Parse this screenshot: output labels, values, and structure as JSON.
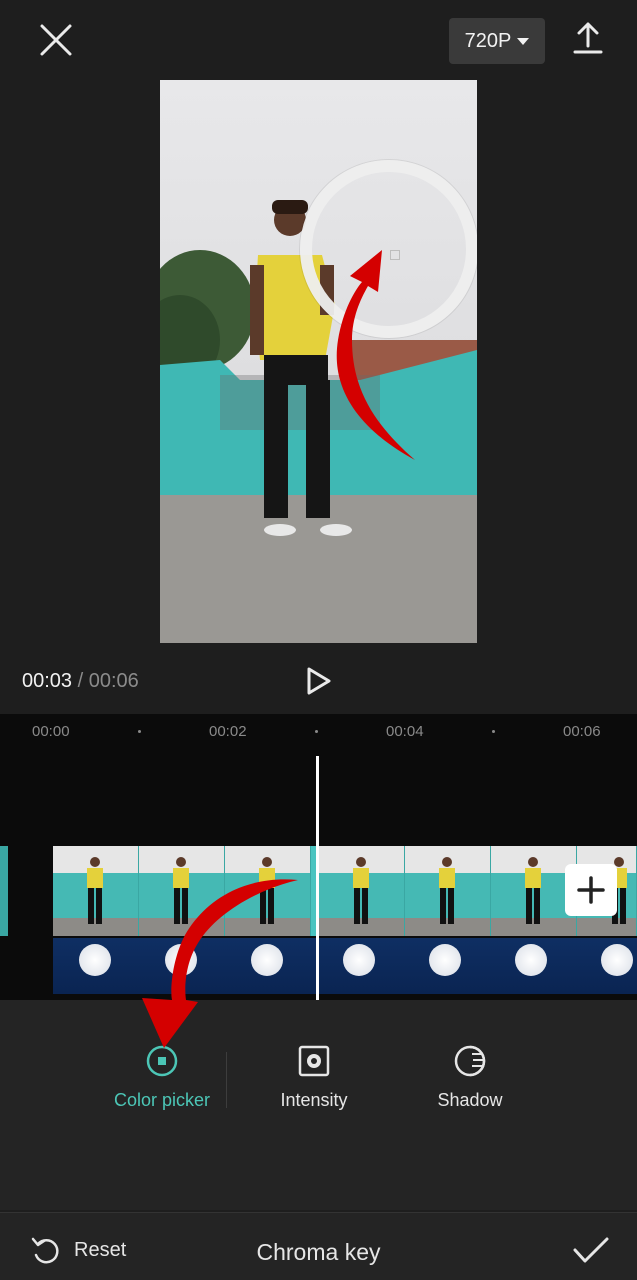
{
  "topbar": {
    "close_icon": "close-icon",
    "resolution_label": "720P",
    "export_icon": "export-upload-icon"
  },
  "preview": {
    "picker_icon": "color-picker-ring"
  },
  "playback": {
    "current_time": "00:03",
    "separator": " / ",
    "total_time": "00:06",
    "play_icon": "play-icon"
  },
  "timeline": {
    "ticks": [
      "00:00",
      "00:02",
      "00:04",
      "00:06"
    ],
    "add_icon": "plus-icon"
  },
  "tools": [
    {
      "label": "Color picker",
      "icon": "color-picker-icon",
      "active": true
    },
    {
      "label": "Intensity",
      "icon": "intensity-icon",
      "active": false
    },
    {
      "label": "Shadow",
      "icon": "shadow-icon",
      "active": false
    }
  ],
  "bottombar": {
    "reset_label": "Reset",
    "title": "Chroma key",
    "confirm_icon": "check-icon"
  },
  "colors": {
    "accent": "#4cc6b6",
    "annotation_arrow": "#d40000"
  }
}
